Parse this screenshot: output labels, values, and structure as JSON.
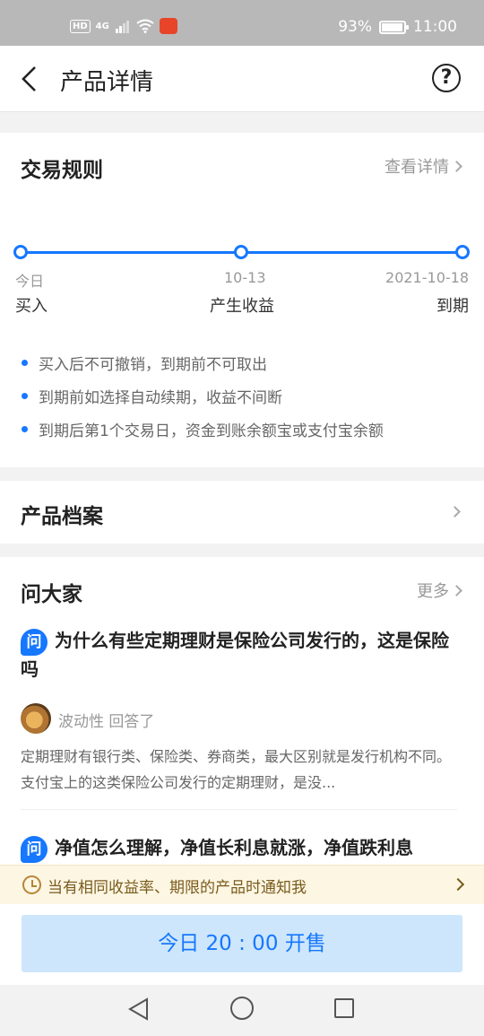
{
  "status": {
    "network": "HD",
    "net_type": "4G",
    "battery": "93%",
    "time": "11:00"
  },
  "nav": {
    "title": "产品详情",
    "help": "?"
  },
  "trade_rules": {
    "title": "交易规则",
    "link": "查看详情",
    "timeline": [
      {
        "date": "今日",
        "label": "买入"
      },
      {
        "date": "10-13",
        "label": "产生收益"
      },
      {
        "date": "2021-10-18",
        "label": "到期"
      }
    ],
    "rules": [
      "买入后不可撤销，到期前不可取出",
      "到期前如选择自动续期，收益不间断",
      "到期后第1个交易日，资金到账余额宝或支付宝余额"
    ]
  },
  "archive": {
    "title": "产品档案"
  },
  "qa": {
    "title": "问大家",
    "more": "更多",
    "badge": "问",
    "items": [
      {
        "question": "为什么有些定期理财是保险公司发行的，这是保险吗",
        "answerer": "波动性 回答了",
        "answer": "定期理财有银行类、保险类、券商类，最大区别就是发行机构不同。支付宝上的这类保险公司发行的定期理财，是没..."
      },
      {
        "question": "净值怎么理解，净值长利息就涨，净值跌利息"
      }
    ]
  },
  "notify": {
    "text": "当有相同收益率、期限的产品时通知我"
  },
  "sale_button": "今日 20 : 00 开售",
  "colors": {
    "accent": "#1677ff",
    "notify_bg": "#fdf6e3",
    "button_bg": "#cde6fb"
  }
}
